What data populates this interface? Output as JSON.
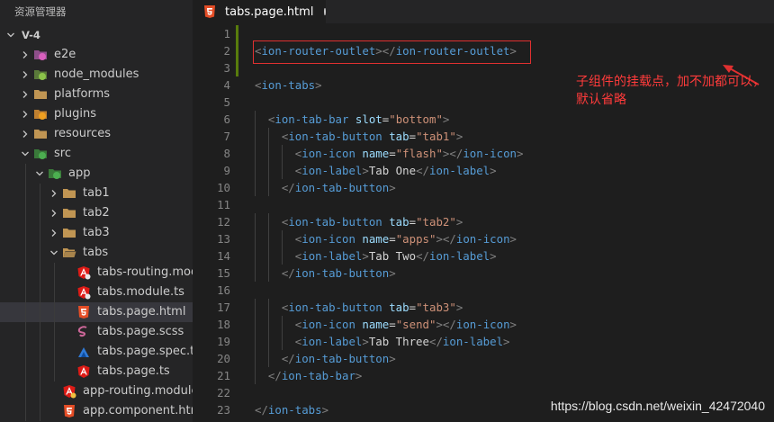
{
  "explorer": {
    "title": "资源管理器",
    "root": "V-4",
    "items": [
      {
        "label": "e2e",
        "depth": 1,
        "chev": "right",
        "icon": "e2e-folder-icon",
        "color": "#d85fbd"
      },
      {
        "label": "node_modules",
        "depth": 1,
        "chev": "right",
        "icon": "node-modules-folder-icon",
        "color": "#8bc34a"
      },
      {
        "label": "platforms",
        "depth": 1,
        "chev": "right",
        "icon": "folder-icon",
        "color": "#c09553"
      },
      {
        "label": "plugins",
        "depth": 1,
        "chev": "right",
        "icon": "plugins-folder-icon",
        "color": "#f0a020"
      },
      {
        "label": "resources",
        "depth": 1,
        "chev": "right",
        "icon": "folder-icon",
        "color": "#c09553"
      },
      {
        "label": "src",
        "depth": 1,
        "chev": "down",
        "icon": "src-folder-icon",
        "color": "#4caf50"
      },
      {
        "label": "app",
        "depth": 2,
        "chev": "down",
        "icon": "app-folder-icon",
        "color": "#4caf50"
      },
      {
        "label": "tab1",
        "depth": 3,
        "chev": "right",
        "icon": "folder-icon",
        "color": "#c09553"
      },
      {
        "label": "tab2",
        "depth": 3,
        "chev": "right",
        "icon": "folder-icon",
        "color": "#c09553"
      },
      {
        "label": "tab3",
        "depth": 3,
        "chev": "right",
        "icon": "folder-icon",
        "color": "#c09553"
      },
      {
        "label": "tabs",
        "depth": 3,
        "chev": "down",
        "icon": "folder-open-icon",
        "color": "#c09553"
      },
      {
        "label": "tabs-routing.module.ts",
        "depth": 4,
        "chev": "none",
        "icon": "angular-routing-icon",
        "color": "#e8e8e8"
      },
      {
        "label": "tabs.module.ts",
        "depth": 4,
        "chev": "none",
        "icon": "angular-module-icon",
        "color": "#e8e8e8"
      },
      {
        "label": "tabs.page.html",
        "depth": 4,
        "chev": "none",
        "icon": "html5-icon",
        "color": "#e44d26",
        "selected": true
      },
      {
        "label": "tabs.page.scss",
        "depth": 4,
        "chev": "none",
        "icon": "sass-icon",
        "color": "#cd6799"
      },
      {
        "label": "tabs.page.spec.ts",
        "depth": 4,
        "chev": "none",
        "icon": "spec-test-icon",
        "color": "#2f7ad6"
      },
      {
        "label": "tabs.page.ts",
        "depth": 4,
        "chev": "none",
        "icon": "angular-icon",
        "color": "#dd1b16"
      },
      {
        "label": "app-routing.module.ts",
        "depth": 3,
        "chev": "none",
        "icon": "angular-routing-icon",
        "color": "#f0c040"
      },
      {
        "label": "app.component.html",
        "depth": 3,
        "chev": "none",
        "icon": "html5-icon",
        "color": "#e44d26"
      }
    ]
  },
  "editor": {
    "tab_title": "tabs.page.html",
    "tab_icon": "html5-icon",
    "modified_lines": [
      1,
      2,
      3
    ],
    "lines": [
      {
        "n": "1",
        "indent": 0,
        "tokens": []
      },
      {
        "n": "2",
        "indent": 0,
        "tokens": [
          [
            "punc",
            "<"
          ],
          [
            "tag",
            "ion-router-outlet"
          ],
          [
            "punc",
            "></"
          ],
          [
            "tag",
            "ion-router-outlet"
          ],
          [
            "punc",
            ">"
          ]
        ]
      },
      {
        "n": "3",
        "indent": 0,
        "tokens": []
      },
      {
        "n": "4",
        "indent": 0,
        "tokens": [
          [
            "punc",
            "<"
          ],
          [
            "tag",
            "ion-tabs"
          ],
          [
            "punc",
            ">"
          ]
        ]
      },
      {
        "n": "5",
        "indent": 0,
        "tokens": []
      },
      {
        "n": "6",
        "indent": 1,
        "tokens": [
          [
            "txt",
            "  "
          ],
          [
            "punc",
            "<"
          ],
          [
            "tag",
            "ion-tab-bar"
          ],
          [
            "txt",
            " "
          ],
          [
            "attr",
            "slot"
          ],
          [
            "txt",
            "="
          ],
          [
            "str",
            "\"bottom\""
          ],
          [
            "punc",
            ">"
          ]
        ]
      },
      {
        "n": "7",
        "indent": 2,
        "tokens": [
          [
            "txt",
            "    "
          ],
          [
            "punc",
            "<"
          ],
          [
            "tag",
            "ion-tab-button"
          ],
          [
            "txt",
            " "
          ],
          [
            "attr",
            "tab"
          ],
          [
            "txt",
            "="
          ],
          [
            "str",
            "\"tab1\""
          ],
          [
            "punc",
            ">"
          ]
        ]
      },
      {
        "n": "8",
        "indent": 3,
        "tokens": [
          [
            "txt",
            "      "
          ],
          [
            "punc",
            "<"
          ],
          [
            "tag",
            "ion-icon"
          ],
          [
            "txt",
            " "
          ],
          [
            "attr",
            "name"
          ],
          [
            "txt",
            "="
          ],
          [
            "str",
            "\"flash\""
          ],
          [
            "punc",
            "></"
          ],
          [
            "tag",
            "ion-icon"
          ],
          [
            "punc",
            ">"
          ]
        ]
      },
      {
        "n": "9",
        "indent": 3,
        "tokens": [
          [
            "txt",
            "      "
          ],
          [
            "punc",
            "<"
          ],
          [
            "tag",
            "ion-label"
          ],
          [
            "punc",
            ">"
          ],
          [
            "txt",
            "Tab One"
          ],
          [
            "punc",
            "</"
          ],
          [
            "tag",
            "ion-label"
          ],
          [
            "punc",
            ">"
          ]
        ]
      },
      {
        "n": "10",
        "indent": 2,
        "tokens": [
          [
            "txt",
            "    "
          ],
          [
            "punc",
            "</"
          ],
          [
            "tag",
            "ion-tab-button"
          ],
          [
            "punc",
            ">"
          ]
        ]
      },
      {
        "n": "11",
        "indent": 0,
        "tokens": []
      },
      {
        "n": "12",
        "indent": 2,
        "tokens": [
          [
            "txt",
            "    "
          ],
          [
            "punc",
            "<"
          ],
          [
            "tag",
            "ion-tab-button"
          ],
          [
            "txt",
            " "
          ],
          [
            "attr",
            "tab"
          ],
          [
            "txt",
            "="
          ],
          [
            "str",
            "\"tab2\""
          ],
          [
            "punc",
            ">"
          ]
        ]
      },
      {
        "n": "13",
        "indent": 3,
        "tokens": [
          [
            "txt",
            "      "
          ],
          [
            "punc",
            "<"
          ],
          [
            "tag",
            "ion-icon"
          ],
          [
            "txt",
            " "
          ],
          [
            "attr",
            "name"
          ],
          [
            "txt",
            "="
          ],
          [
            "str",
            "\"apps\""
          ],
          [
            "punc",
            "></"
          ],
          [
            "tag",
            "ion-icon"
          ],
          [
            "punc",
            ">"
          ]
        ]
      },
      {
        "n": "14",
        "indent": 3,
        "tokens": [
          [
            "txt",
            "      "
          ],
          [
            "punc",
            "<"
          ],
          [
            "tag",
            "ion-label"
          ],
          [
            "punc",
            ">"
          ],
          [
            "txt",
            "Tab Two"
          ],
          [
            "punc",
            "</"
          ],
          [
            "tag",
            "ion-label"
          ],
          [
            "punc",
            ">"
          ]
        ]
      },
      {
        "n": "15",
        "indent": 2,
        "tokens": [
          [
            "txt",
            "    "
          ],
          [
            "punc",
            "</"
          ],
          [
            "tag",
            "ion-tab-button"
          ],
          [
            "punc",
            ">"
          ]
        ]
      },
      {
        "n": "16",
        "indent": 0,
        "tokens": []
      },
      {
        "n": "17",
        "indent": 2,
        "tokens": [
          [
            "txt",
            "    "
          ],
          [
            "punc",
            "<"
          ],
          [
            "tag",
            "ion-tab-button"
          ],
          [
            "txt",
            " "
          ],
          [
            "attr",
            "tab"
          ],
          [
            "txt",
            "="
          ],
          [
            "str",
            "\"tab3\""
          ],
          [
            "punc",
            ">"
          ]
        ]
      },
      {
        "n": "18",
        "indent": 3,
        "tokens": [
          [
            "txt",
            "      "
          ],
          [
            "punc",
            "<"
          ],
          [
            "tag",
            "ion-icon"
          ],
          [
            "txt",
            " "
          ],
          [
            "attr",
            "name"
          ],
          [
            "txt",
            "="
          ],
          [
            "str",
            "\"send\""
          ],
          [
            "punc",
            "></"
          ],
          [
            "tag",
            "ion-icon"
          ],
          [
            "punc",
            ">"
          ]
        ]
      },
      {
        "n": "19",
        "indent": 3,
        "tokens": [
          [
            "txt",
            "      "
          ],
          [
            "punc",
            "<"
          ],
          [
            "tag",
            "ion-label"
          ],
          [
            "punc",
            ">"
          ],
          [
            "txt",
            "Tab Three"
          ],
          [
            "punc",
            "</"
          ],
          [
            "tag",
            "ion-label"
          ],
          [
            "punc",
            ">"
          ]
        ]
      },
      {
        "n": "20",
        "indent": 2,
        "tokens": [
          [
            "txt",
            "    "
          ],
          [
            "punc",
            "</"
          ],
          [
            "tag",
            "ion-tab-button"
          ],
          [
            "punc",
            ">"
          ]
        ]
      },
      {
        "n": "21",
        "indent": 1,
        "tokens": [
          [
            "txt",
            "  "
          ],
          [
            "punc",
            "</"
          ],
          [
            "tag",
            "ion-tab-bar"
          ],
          [
            "punc",
            ">"
          ]
        ]
      },
      {
        "n": "22",
        "indent": 0,
        "tokens": []
      },
      {
        "n": "23",
        "indent": 0,
        "tokens": [
          [
            "punc",
            "</"
          ],
          [
            "tag",
            "ion-tabs"
          ],
          [
            "punc",
            ">"
          ]
        ]
      }
    ]
  },
  "annotation": {
    "text": "子组件的挂载点，加不加都可以，默认省略",
    "color": "#e03030"
  },
  "watermark": "https://blog.csdn.net/weixin_42472040"
}
